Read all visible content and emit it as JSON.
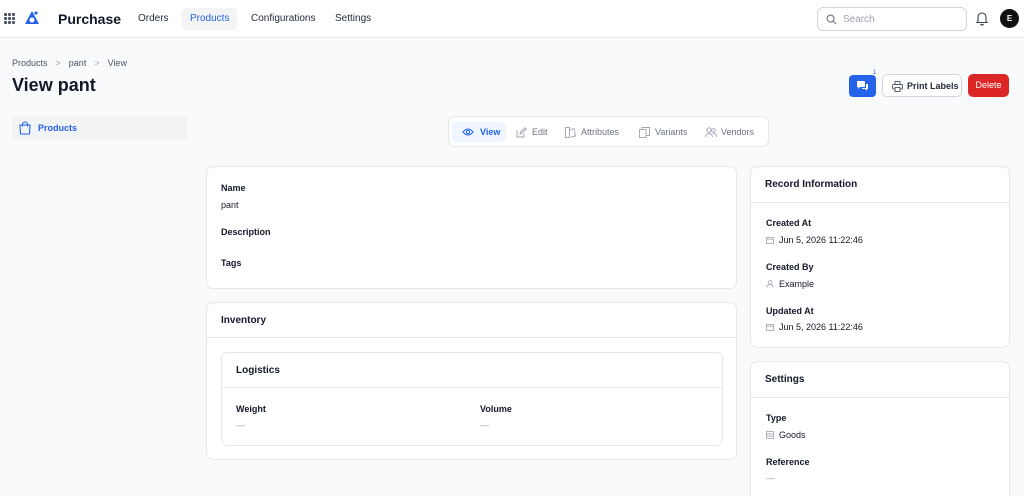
{
  "app": {
    "name": "Purchase",
    "user_initial": "E"
  },
  "nav": {
    "items": [
      "Orders",
      "Products",
      "Configurations",
      "Settings"
    ],
    "active": "Products"
  },
  "search": {
    "placeholder": "Search"
  },
  "breadcrumb": [
    "Products",
    "pant",
    "View"
  ],
  "page": {
    "title": "View pant"
  },
  "actions": {
    "chat_count": "1",
    "print_label": "Print Labels",
    "delete_label": "Delete"
  },
  "sidebar": {
    "items": [
      {
        "label": "Products",
        "icon": "shopping-bag-icon"
      }
    ]
  },
  "tabs": [
    {
      "label": "View",
      "icon": "eye-icon",
      "active": true
    },
    {
      "label": "Edit",
      "icon": "edit-icon"
    },
    {
      "label": "Attributes",
      "icon": "attributes-icon"
    },
    {
      "label": "Variants",
      "icon": "variants-icon"
    },
    {
      "label": "Vendors",
      "icon": "vendors-icon"
    }
  ],
  "details": {
    "name_label": "Name",
    "name_value": "pant",
    "description_label": "Description",
    "tags_label": "Tags"
  },
  "inventory": {
    "title": "Inventory",
    "logistics": {
      "title": "Logistics",
      "weight_label": "Weight",
      "weight_value": "—",
      "volume_label": "Volume",
      "volume_value": "—"
    }
  },
  "record": {
    "title": "Record Information",
    "created_at_label": "Created At",
    "created_at": "Jun 5, 2026 11:22:46",
    "created_by_label": "Created By",
    "created_by": "Example",
    "updated_at_label": "Updated At",
    "updated_at": "Jun 5, 2026 11:22:46"
  },
  "settings": {
    "title": "Settings",
    "type_label": "Type",
    "type_value": "Goods",
    "reference_label": "Reference",
    "reference_value": "—"
  },
  "colors": {
    "accent": "#2563eb",
    "danger": "#dc2626",
    "active_tab_bg": "#eff6ff"
  }
}
